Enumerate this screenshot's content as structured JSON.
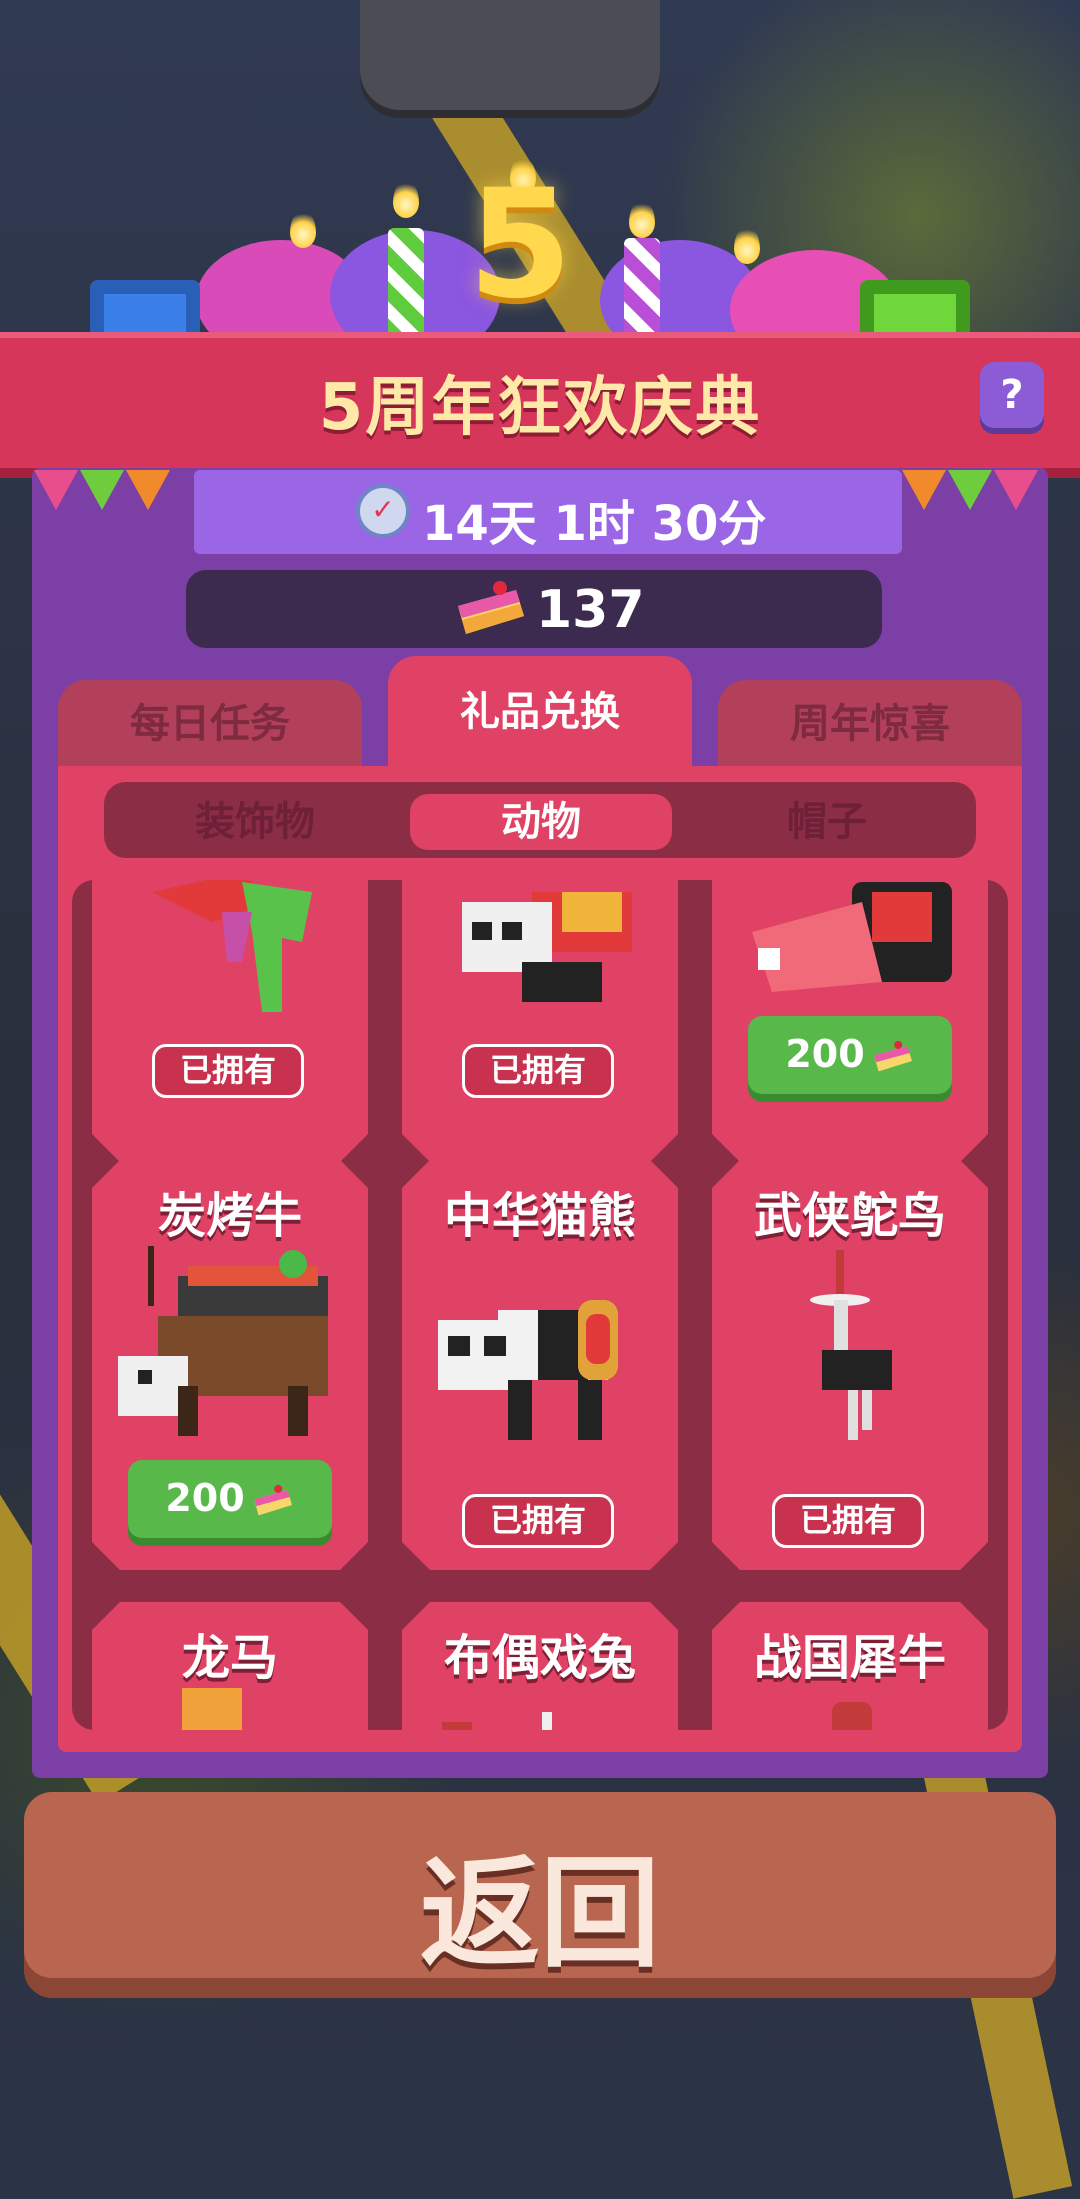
{
  "title": "5周年狂欢庆典",
  "help_icon": "question-icon",
  "anniversary_number": "5",
  "timer": {
    "icon": "clock-check-icon",
    "text": "14天 1时 30分"
  },
  "currency": {
    "icon": "cake-icon",
    "amount": "137"
  },
  "tabs": [
    {
      "label": "每日任务",
      "active": false
    },
    {
      "label": "礼品兑换",
      "active": true
    },
    {
      "label": "周年惊喜",
      "active": false
    }
  ],
  "subtabs": [
    {
      "label": "装饰物",
      "active": false
    },
    {
      "label": "动物",
      "active": true
    },
    {
      "label": "帽子",
      "active": false
    }
  ],
  "items": [
    {
      "name": "",
      "status": "owned",
      "status_label": "已拥有"
    },
    {
      "name": "",
      "status": "owned",
      "status_label": "已拥有"
    },
    {
      "name": "",
      "status": "buy",
      "price": "200"
    },
    {
      "name": "炭烤牛",
      "status": "buy",
      "price": "200"
    },
    {
      "name": "中华猫熊",
      "status": "owned",
      "status_label": "已拥有"
    },
    {
      "name": "武侠鸵鸟",
      "status": "owned",
      "status_label": "已拥有"
    },
    {
      "name": "龙马"
    },
    {
      "name": "布偶戏兔"
    },
    {
      "name": "战国犀牛"
    }
  ],
  "back_button": "返回",
  "colors": {
    "banner": "#d6365a",
    "panel": "#7b3fa6",
    "card": "#df4265",
    "buy_green": "#58b84a",
    "back": "#b8664f"
  }
}
